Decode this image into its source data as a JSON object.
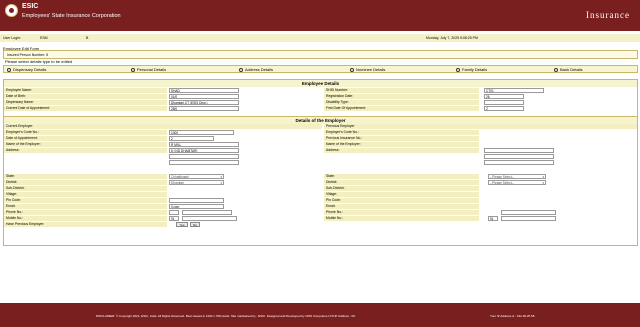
{
  "header": {
    "title": "ESIC",
    "subtitle": "Employees' State Insurance Corporation",
    "right_title": "Insurance"
  },
  "userbar": {
    "user_label": "User Login:",
    "user_id": "ESM",
    "user_suffix": "B",
    "datetime": "Monday, July 7, 2025 5:08:25 PM"
  },
  "form": {
    "title": "Employee Edit Form",
    "ip_label": "Insured Person Number: 5",
    "ip_value": "",
    "note": "Please select details type to be edited"
  },
  "radios": [
    "Dispensary Details",
    "Personal Details",
    "Address Details",
    "Nominee Details",
    "Family Details",
    "Bank Details"
  ],
  "employee_details": {
    "heading": "Employee Details",
    "left": [
      {
        "label": "Employee Name:",
        "value": "SHAD"
      },
      {
        "label": "Date of Birth:",
        "value": "01/0"
      },
      {
        "label": "Dispensary Name:",
        "value": "Dhamtari,CT (ESIS Disp.)"
      },
      {
        "label": "Current Date of Appointment:",
        "value": "28/0"
      }
    ],
    "right": [
      {
        "label": "SHID Number:",
        "value": "CT01"
      },
      {
        "label": "Registration Date:",
        "value": "26"
      },
      {
        "label": "Disability Type:",
        "value": ""
      },
      {
        "label": "First Date Of Appointment:",
        "value": "2"
      }
    ]
  },
  "employer_details": {
    "heading": "Details of the Employer",
    "left_title": "Current Employer",
    "right_title": "Previous Employer",
    "left": [
      {
        "label": "Employer's Code No.:",
        "value": "1000"
      },
      {
        "label": "Date of Appointment:",
        "value": "2"
      },
      {
        "label": "Name of the Employer:",
        "value": "R          MILL"
      },
      {
        "label": "Address:",
        "value": "5 I           ND DHAMTARI"
      }
    ],
    "right": [
      {
        "label": "Employer's Code No.:",
        "value": ""
      },
      {
        "label": "Previous Insurance No.:",
        "value": ""
      },
      {
        "label": "Name of the Employer:",
        "value": ""
      },
      {
        "label": "Address:",
        "value": ""
      }
    ]
  },
  "address_rows": {
    "left": [
      {
        "label": "State:",
        "value": "Chhattisgarh"
      },
      {
        "label": "District:",
        "value": "Dhamtari"
      },
      {
        "label": "Sub-District:",
        "value": ""
      },
      {
        "label": "Village:",
        "value": ""
      },
      {
        "label": "Pin Code:",
        "value": ""
      },
      {
        "label": "Email:",
        "value": "ll              com"
      },
      {
        "label": "Phone No.:",
        "value": ""
      },
      {
        "label": "Mobile No.:",
        "value": "91"
      }
    ],
    "right": [
      {
        "label": "State:",
        "value": "--Please Select--"
      },
      {
        "label": "District:",
        "value": "--Please Select--"
      },
      {
        "label": "Sub-District:",
        "value": ""
      },
      {
        "label": "Village:",
        "value": ""
      },
      {
        "label": "Pin Code:",
        "value": ""
      },
      {
        "label": "Email:",
        "value": ""
      },
      {
        "label": "Phone No.:",
        "value": ""
      },
      {
        "label": "Mobile No.:",
        "value": "91"
      }
    ],
    "have_previous_label": "Have Previous Employer:",
    "have_previous_yes": "Yes",
    "have_previous_no": "No"
  },
  "footer": {
    "disclaimer": "DISCLAIMER: © Copyright 2021, ESIC, India. All Rights Reserved. Best viewed in 1024 x 768 pixels. Site maintained by : ESIC. Designed and Developed by CMS Computers LTD.IP Address : 00.",
    "ip": "Your IP Address is : 192.00.25.58"
  },
  "colors": {
    "header_bg": "#7a1f1f",
    "label_bg": "#f3efc0",
    "border": "#c9b866"
  }
}
